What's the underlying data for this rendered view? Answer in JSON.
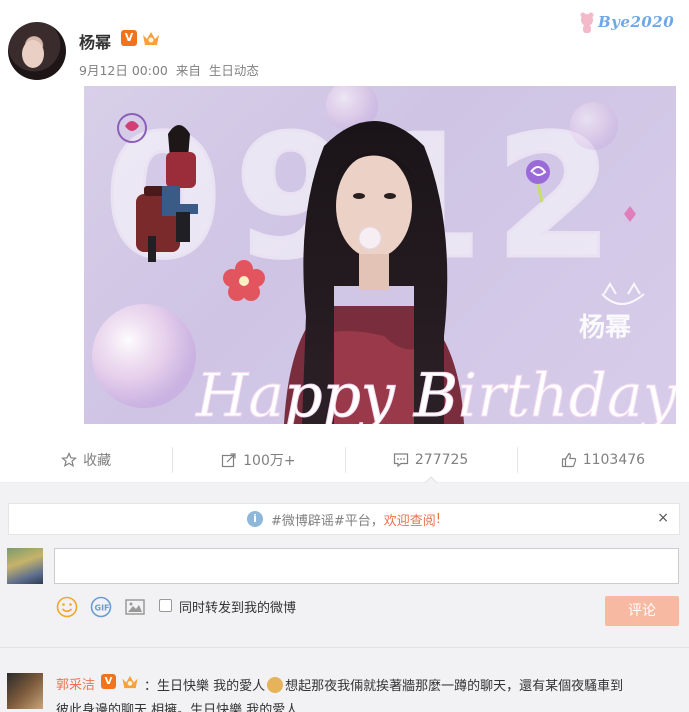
{
  "post": {
    "author": "杨幂",
    "verified_mark": "V",
    "time": "9月12日 00:00",
    "source_prefix": "来自",
    "source": "生日动态",
    "badge_text": "Bye2020"
  },
  "image": {
    "big_number": "0912",
    "script_text": "Happy Birthday",
    "signature": "杨幂"
  },
  "actions": [
    {
      "label": "收藏",
      "icon": "star-icon"
    },
    {
      "label": "100万+",
      "icon": "share-icon"
    },
    {
      "label": "277725",
      "icon": "comment-icon"
    },
    {
      "label": "1103476",
      "icon": "like-icon"
    }
  ],
  "notice": {
    "prefix": "#微博辟谣#平台，",
    "highlight": "欢迎查阅",
    "suffix": "!",
    "close": "×"
  },
  "composer": {
    "placeholder": "",
    "repost_label": "同时转发到我的微博",
    "submit_label": "评论"
  },
  "comment": {
    "author": "郭采洁",
    "verified_mark": "V",
    "line1_a": "：生日快樂 我的愛人",
    "line1_b": "想起那夜我倆就挨著牆那麼一蹲的聊天，還有某個夜騷車到",
    "line2": "彼此身邊的聊天 相擁。生日快樂 我的愛人"
  },
  "colors": {
    "accent": "#eb7350",
    "submit_disabled": "#f7b9a1",
    "verified": "#f0741e"
  }
}
